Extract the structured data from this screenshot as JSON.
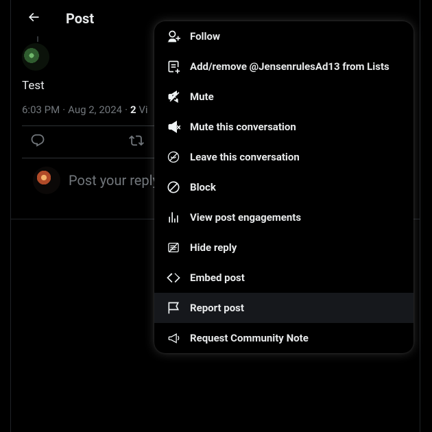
{
  "header": {
    "title": "Post"
  },
  "post": {
    "text": "Test",
    "time": "6:03 PM",
    "date": "Aug 2, 2024",
    "views_count": "2",
    "views_label_partial": "Vi"
  },
  "reply": {
    "placeholder": "Post your reply"
  },
  "menu": {
    "items": [
      {
        "key": "follow",
        "label": "Follow",
        "icon": "follow-icon",
        "highlight": false
      },
      {
        "key": "lists",
        "label": "Add/remove @JensenrulesAd13 from Lists",
        "icon": "list-icon",
        "highlight": false
      },
      {
        "key": "mute",
        "label": "Mute",
        "icon": "mute-icon",
        "highlight": false
      },
      {
        "key": "mute-conv",
        "label": "Mute this conversation",
        "icon": "mute-conv-icon",
        "highlight": false
      },
      {
        "key": "leave-conv",
        "label": "Leave this conversation",
        "icon": "leave-conv-icon",
        "highlight": false
      },
      {
        "key": "block",
        "label": "Block",
        "icon": "block-icon",
        "highlight": false
      },
      {
        "key": "engagements",
        "label": "View post engagements",
        "icon": "analytics-icon",
        "highlight": false
      },
      {
        "key": "hide-reply",
        "label": "Hide reply",
        "icon": "hide-reply-icon",
        "highlight": false
      },
      {
        "key": "embed",
        "label": "Embed post",
        "icon": "embed-icon",
        "highlight": false
      },
      {
        "key": "report",
        "label": "Report post",
        "icon": "flag-icon",
        "highlight": true
      },
      {
        "key": "community-note",
        "label": "Request Community Note",
        "icon": "megaphone-icon",
        "highlight": false
      }
    ]
  }
}
